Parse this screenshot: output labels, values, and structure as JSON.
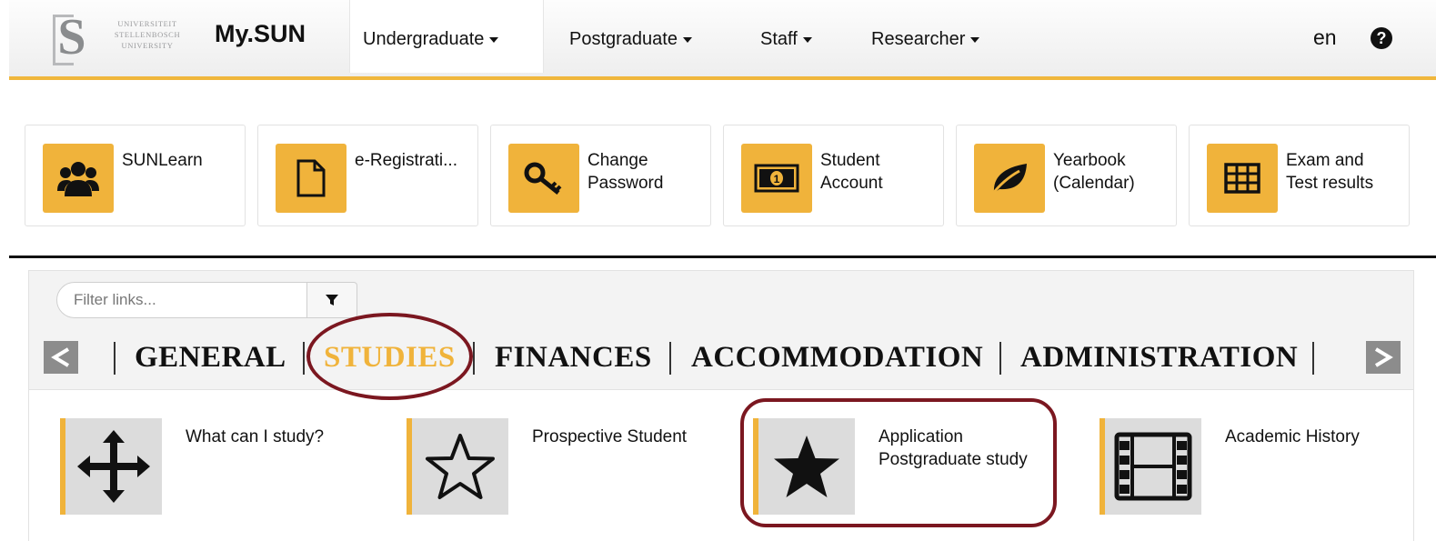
{
  "logo": {
    "mark": "S",
    "lines": [
      "UNIVERSITEIT",
      "STELLENBOSCH",
      "UNIVERSITY"
    ]
  },
  "brand": "My.SUN",
  "nav": [
    {
      "label": "Undergraduate",
      "active": true
    },
    {
      "label": "Postgraduate",
      "active": false
    },
    {
      "label": "Staff",
      "active": false
    },
    {
      "label": "Researcher",
      "active": false
    }
  ],
  "language": "en",
  "help_icon": "question-circle-icon",
  "tiles": [
    {
      "label": "SUNLearn",
      "icon": "users-icon"
    },
    {
      "label": "e-Registrati...",
      "icon": "file-icon"
    },
    {
      "label": "Change\nPassword",
      "icon": "key-icon"
    },
    {
      "label": "Student\nAccount",
      "icon": "money-icon"
    },
    {
      "label": "Yearbook\n(Calendar)",
      "icon": "leaf-icon"
    },
    {
      "label": "Exam and\nTest results",
      "icon": "table-icon"
    }
  ],
  "filter": {
    "placeholder": "Filter links...",
    "icon": "filter-icon"
  },
  "categories": [
    {
      "label": "GENERAL",
      "active": false
    },
    {
      "label": "STUDIES",
      "active": true
    },
    {
      "label": "FINANCES",
      "active": false
    },
    {
      "label": "ACCOMMODATION",
      "active": false
    },
    {
      "label": "ADMINISTRATION",
      "active": false
    }
  ],
  "links": [
    {
      "label": "What can I study?",
      "icon": "arrows-move-icon"
    },
    {
      "label": "Prospective Student",
      "icon": "star-outline-icon"
    },
    {
      "label": "Application\nPostgraduate study",
      "icon": "star-icon"
    },
    {
      "label": "Academic History",
      "icon": "film-icon"
    }
  ],
  "colors": {
    "accent": "#f0b33b",
    "annotation": "#7b1720"
  }
}
